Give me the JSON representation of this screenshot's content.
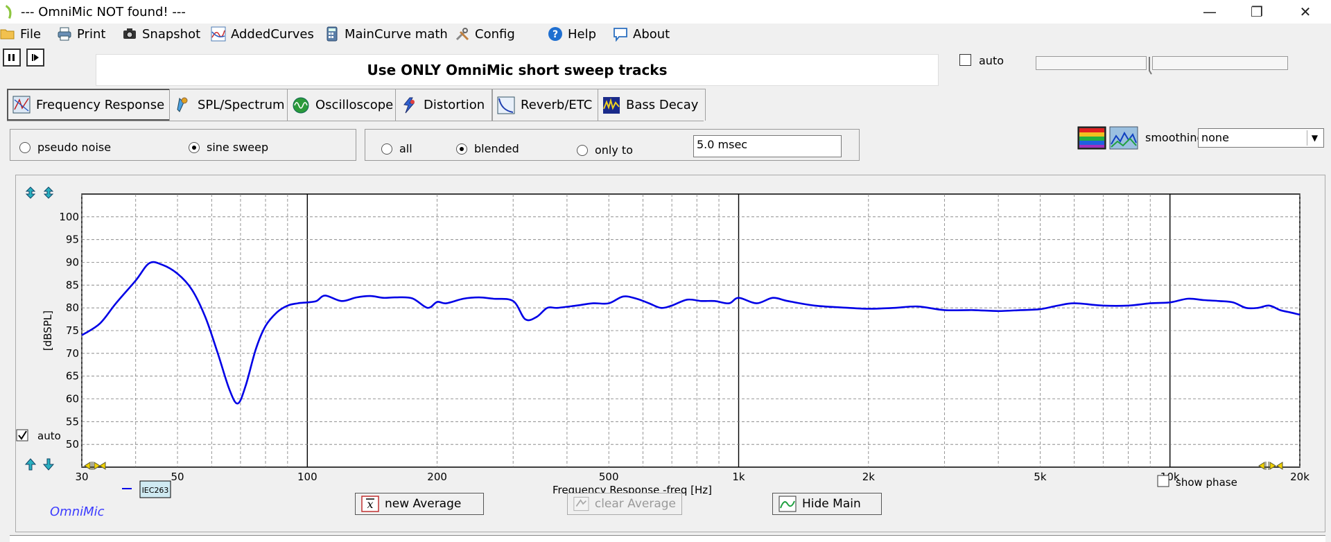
{
  "window": {
    "title": "--- OmniMic NOT found! ---",
    "controls": {
      "minimize": "—",
      "restore": "❐",
      "close": "✕"
    }
  },
  "menu": [
    {
      "label": "File",
      "icon": "folder-icon"
    },
    {
      "label": "Print",
      "icon": "printer-icon"
    },
    {
      "label": "Snapshot",
      "icon": "camera-icon"
    },
    {
      "label": "AddedCurves",
      "icon": "curves-icon"
    },
    {
      "label": "MainCurve math",
      "icon": "calculator-icon"
    },
    {
      "label": "Config",
      "icon": "tools-icon"
    },
    {
      "label": "Help",
      "icon": "help-icon"
    },
    {
      "label": "About",
      "icon": "speech-bubble-icon"
    }
  ],
  "banner": "Use ONLY OmniMic short sweep tracks",
  "top_auto_label": "auto",
  "tabs": [
    {
      "label": "Frequency Response",
      "active": true
    },
    {
      "label": "SPL/Spectrum",
      "active": false
    },
    {
      "label": "Oscilloscope",
      "active": false
    },
    {
      "label": "Distortion",
      "active": false
    },
    {
      "label": "Reverb/ETC",
      "active": false
    },
    {
      "label": "Bass Decay",
      "active": false
    }
  ],
  "signal_options": [
    {
      "label": "pseudo noise",
      "selected": false
    },
    {
      "label": "sine sweep",
      "selected": true
    }
  ],
  "window_options": [
    {
      "label": "all",
      "selected": false
    },
    {
      "label": "blended",
      "selected": true
    },
    {
      "label": "only to",
      "selected": false
    }
  ],
  "gate_value": "5.0 msec",
  "smoothing": {
    "label": "smoothing",
    "value": "none"
  },
  "chart_data": {
    "type": "line",
    "x_scale": "log",
    "xlabel": "Frequency Response -freq [Hz]",
    "ylabel": "[dBSPL]",
    "xlim": [
      30,
      20000
    ],
    "ylim": [
      45,
      105
    ],
    "x_ticks": [
      {
        "v": 30,
        "label": "30"
      },
      {
        "v": 50,
        "label": "50"
      },
      {
        "v": 100,
        "label": "100"
      },
      {
        "v": 200,
        "label": "200"
      },
      {
        "v": 500,
        "label": "500"
      },
      {
        "v": 1000,
        "label": "1k"
      },
      {
        "v": 2000,
        "label": "2k"
      },
      {
        "v": 5000,
        "label": "5k"
      },
      {
        "v": 10000,
        "label": "10k"
      },
      {
        "v": 20000,
        "label": "20k"
      }
    ],
    "y_ticks": [
      50,
      55,
      60,
      65,
      70,
      75,
      80,
      85,
      90,
      95,
      100
    ],
    "grid": true,
    "auto_label": "auto",
    "show_phase_label": "show phase",
    "legend_tag": "IEC263",
    "brand": "OmniMic",
    "series": [
      {
        "color": "#0000e6",
        "x": [
          30,
          33,
          36,
          40,
          43,
          46,
          50,
          54,
          58,
          62,
          66,
          69,
          72,
          76,
          80,
          85,
          90,
          95,
          100,
          105,
          110,
          120,
          130,
          140,
          150,
          160,
          175,
          190,
          200,
          210,
          230,
          250,
          270,
          300,
          320,
          340,
          360,
          380,
          420,
          460,
          500,
          540,
          580,
          620,
          660,
          700,
          760,
          820,
          880,
          950,
          1000,
          1100,
          1200,
          1300,
          1500,
          1800,
          2000,
          2300,
          2600,
          3000,
          3500,
          4000,
          4500,
          5000,
          5500,
          6000,
          7000,
          8000,
          9000,
          10000,
          11000,
          12000,
          13000,
          14000,
          15000,
          16000,
          17000,
          18000,
          19000,
          20000
        ],
        "y": [
          74,
          76.5,
          81,
          86,
          89.8,
          89.5,
          87.5,
          84,
          78,
          70,
          62,
          59,
          63,
          71,
          76,
          79,
          80.5,
          81,
          81.2,
          81.5,
          82.7,
          81.5,
          82.3,
          82.6,
          82.2,
          82.3,
          82.1,
          80,
          81.3,
          81,
          82,
          82.3,
          82,
          81.5,
          77.5,
          78,
          80,
          80,
          80.5,
          81,
          81,
          82.5,
          82,
          81,
          80,
          80.5,
          81.8,
          81.5,
          81.5,
          81,
          82.2,
          81,
          82.2,
          81.5,
          80.5,
          80,
          79.8,
          80,
          80.3,
          79.5,
          79.5,
          79.3,
          79.5,
          79.7,
          80.5,
          81,
          80.5,
          80.5,
          81,
          81.2,
          82,
          81.7,
          81.5,
          81.2,
          80,
          80,
          80.5,
          79.5,
          79,
          78.5
        ]
      }
    ]
  },
  "buttons": {
    "new_average": "new Average",
    "clear_average": "clear Average",
    "hide_main": "Hide Main"
  }
}
